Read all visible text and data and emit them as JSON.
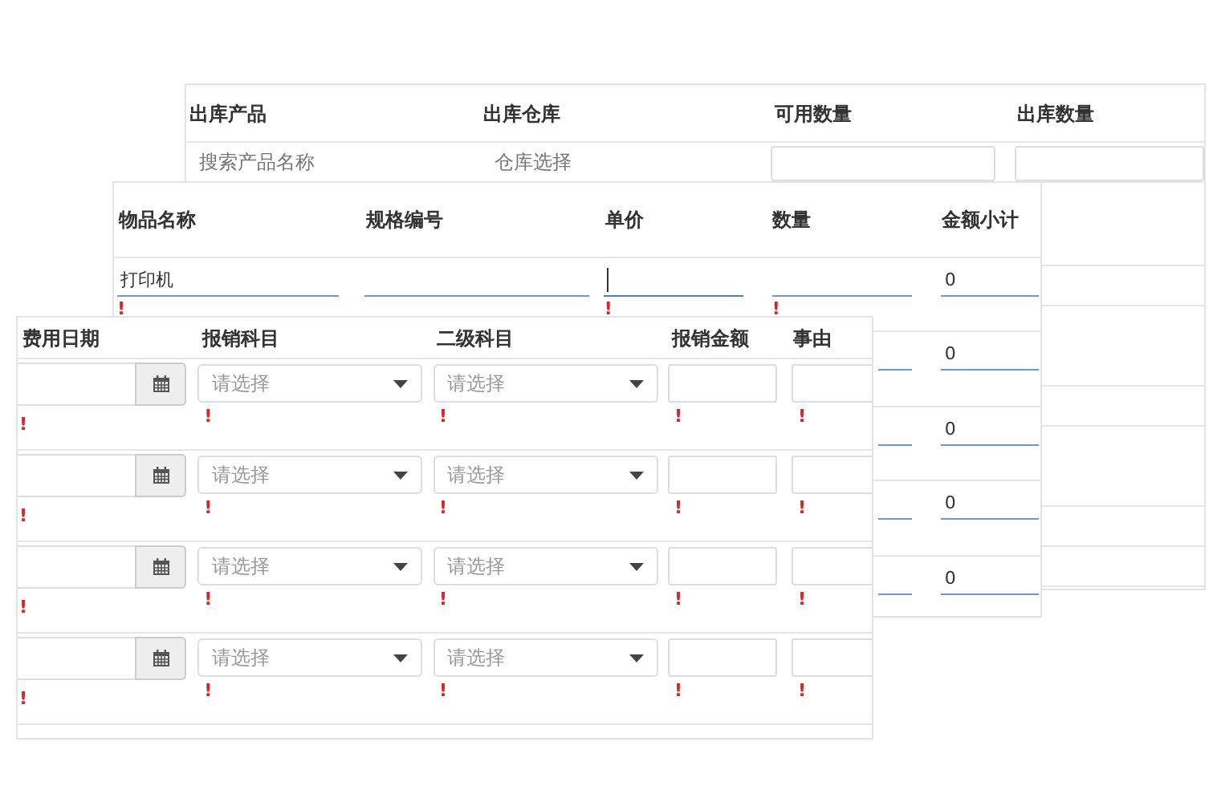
{
  "outbound_form": {
    "columns": [
      "出库产品",
      "出库仓库",
      "可用数量",
      "出库数量"
    ],
    "search_row": {
      "product_placeholder": "搜索产品名称",
      "warehouse_placeholder": "仓库选择"
    }
  },
  "items_form": {
    "columns": [
      "物品名称",
      "规格编号",
      "单价",
      "数量",
      "金额小计"
    ],
    "rows": [
      {
        "name": "打印机",
        "price_focused": true,
        "subtotal": "0",
        "marks": {
          "name": "!",
          "price": "!",
          "qty": "!"
        }
      },
      {
        "subtotal": "0"
      },
      {
        "subtotal": "0"
      },
      {
        "subtotal": "0"
      },
      {
        "subtotal": "0"
      }
    ]
  },
  "expense_form": {
    "columns": [
      "费用日期",
      "报销科目",
      "二级科目",
      "报销金额",
      "事由"
    ],
    "rows": [
      {
        "category_placeholder": "请选择",
        "subcategory_placeholder": "请选择",
        "marks": [
          "!",
          "!",
          "!",
          "!",
          "!"
        ]
      },
      {
        "category_placeholder": "请选择",
        "subcategory_placeholder": "请选择",
        "marks": [
          "!",
          "!",
          "!",
          "!",
          "!"
        ]
      },
      {
        "category_placeholder": "请选择",
        "subcategory_placeholder": "请选择",
        "marks": [
          "!",
          "!",
          "!",
          "!",
          "!"
        ]
      },
      {
        "category_placeholder": "请选择",
        "subcategory_placeholder": "请选择",
        "marks": [
          "!",
          "!",
          "!",
          "!",
          "!"
        ]
      }
    ]
  }
}
